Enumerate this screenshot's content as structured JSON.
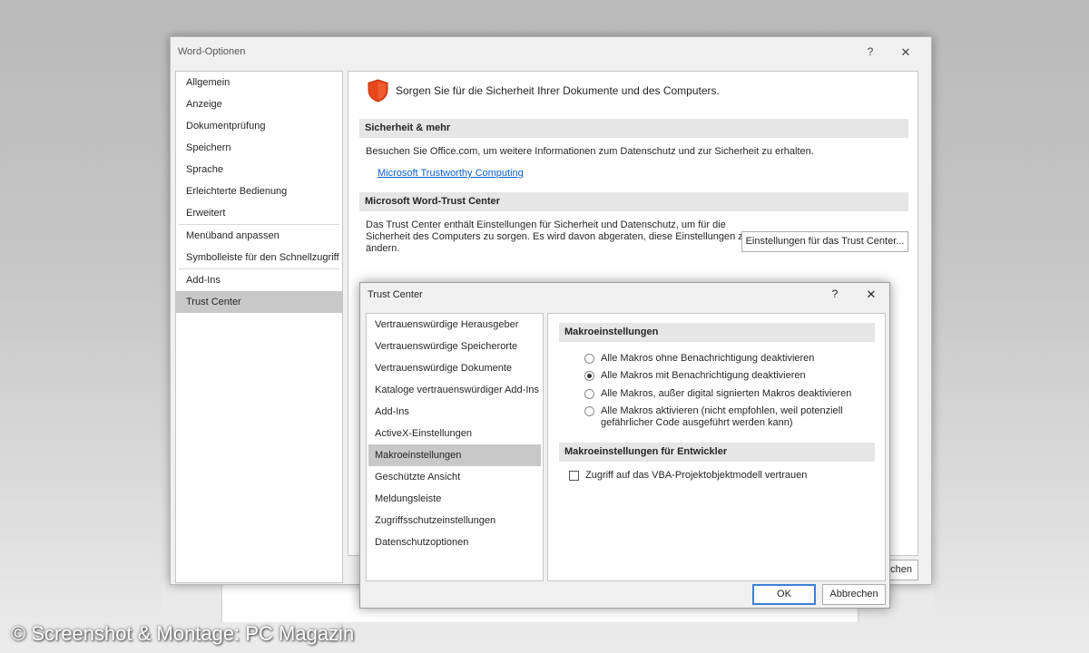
{
  "word_options": {
    "title": "Word-Optionen",
    "help": "?",
    "close": "✕",
    "nav": [
      {
        "label": "Allgemein"
      },
      {
        "label": "Anzeige"
      },
      {
        "label": "Dokumentprüfung"
      },
      {
        "label": "Speichern"
      },
      {
        "label": "Sprache"
      },
      {
        "label": "Erleichterte Bedienung"
      },
      {
        "label": "Erweitert"
      },
      {
        "label": "Menüband anpassen"
      },
      {
        "label": "Symbolleiste für den Schnellzugriff"
      },
      {
        "label": "Add-Ins"
      },
      {
        "label": "Trust Center"
      }
    ],
    "heading": "Sorgen Sie für die Sicherheit Ihrer Dokumente und des Computers.",
    "section1_title": "Sicherheit & mehr",
    "section1_text": "Besuchen Sie Office.com, um weitere Informationen zum Datenschutz und zur Sicherheit zu erhalten.",
    "section1_link": "Microsoft Trustworthy Computing",
    "section2_title": "Microsoft Word-Trust Center",
    "section2_text_line1": "Das Trust Center enthält Einstellungen für Sicherheit und Datenschutz, um für die",
    "section2_text_line2": "Sicherheit des Computers zu sorgen. Es wird davon abgeraten, diese Einstellungen zu",
    "section2_text_line3": "ändern.",
    "trust_center_button": "Einstellungen für das Trust Center...",
    "cancel_partial": "chen"
  },
  "trust_center": {
    "title": "Trust Center",
    "help": "?",
    "close": "✕",
    "nav": [
      {
        "label": "Vertrauenswürdige Herausgeber"
      },
      {
        "label": "Vertrauenswürdige Speicherorte"
      },
      {
        "label": "Vertrauenswürdige Dokumente"
      },
      {
        "label": "Kataloge vertrauenswürdiger Add-Ins"
      },
      {
        "label": "Add-Ins"
      },
      {
        "label": "ActiveX-Einstellungen"
      },
      {
        "label": "Makroeinstellungen"
      },
      {
        "label": "Geschützte Ansicht"
      },
      {
        "label": "Meldungsleiste"
      },
      {
        "label": "Zugriffsschutzeinstellungen"
      },
      {
        "label": "Datenschutzoptionen"
      }
    ],
    "macro_section_title": "Makroeinstellungen",
    "macro_options": [
      {
        "label": "Alle Makros ohne Benachrichtigung deaktivieren",
        "selected": false
      },
      {
        "label": "Alle Makros mit Benachrichtigung deaktivieren",
        "selected": true
      },
      {
        "label": "Alle Makros, außer digital signierten Makros deaktivieren",
        "selected": false
      },
      {
        "label": "Alle Makros aktivieren (nicht empfohlen, weil potenziell",
        "label2": "gefährlicher Code ausgeführt werden kann)",
        "selected": false
      }
    ],
    "dev_section_title": "Makroeinstellungen für Entwickler",
    "vba_checkbox_label": "Zugriff auf das VBA-Projektobjektmodell vertrauen",
    "vba_checked": false,
    "ok_label": "OK",
    "cancel_label": "Abbrechen"
  },
  "watermark": "© Screenshot & Montage: PC Magazin",
  "colors": {
    "shield": "#e8471c",
    "link": "#0b5fc8",
    "selection": "#c8c8c8",
    "ok_border": "#3c7fd6"
  }
}
